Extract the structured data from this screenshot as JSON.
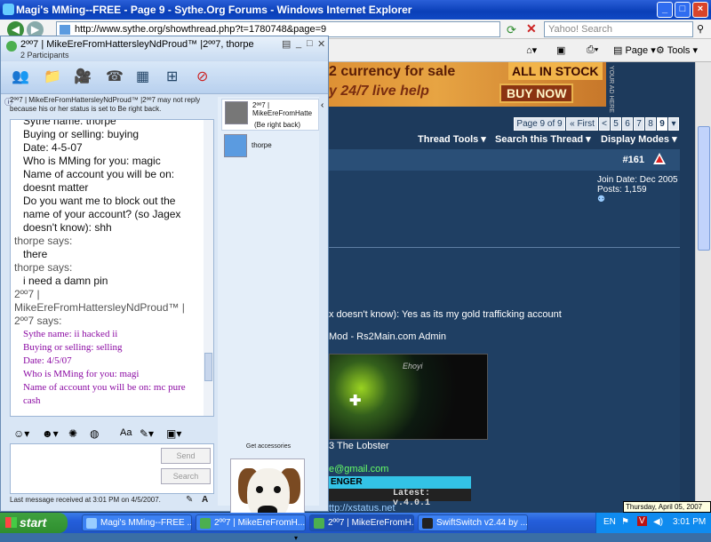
{
  "ie": {
    "title": "Magi's MMing--FREE - Page 9 - Sythe.Org Forums - Windows Internet Explorer",
    "url": "http://www.sythe.org/showthread.php?t=1780748&page=9",
    "search_placeholder": "Yahoo! Search",
    "cmd": {
      "page": "Page",
      "tools": "Tools"
    }
  },
  "banner": {
    "line1": "2 currency for sale",
    "line2": "y 24/7 live help",
    "stock": "ALL IN STOCK",
    "buy": "BUY NOW",
    "ad": "YOUR AD HERE"
  },
  "forum": {
    "pageof": "Page 9 of 9",
    "first": "« First",
    "prev": "<",
    "pages": [
      "5",
      "6",
      "7",
      "8",
      "9"
    ],
    "thread_tools": "Thread Tools",
    "search_thread": "Search this Thread",
    "display_modes": "Display Modes",
    "post_no": "#161",
    "join_date": "Join Date: Dec 2005",
    "posts": "Posts: 1,159",
    "text1": "x doesn't know): Yes as its my gold trafficking account",
    "text2": "Mod - Rs2Main.com Admin",
    "sig_name": "Ehoyi",
    "text3": "3 The Lobster",
    "email": "e@gmail.com",
    "status_label": "ENGER",
    "latest": "Latest: v.4.0.1",
    "status_url": "ttp://xstatus.net"
  },
  "msn": {
    "title": "2ºº7 | MikeEreFromHattersleyNdProud™ |2ºº7, thorpe",
    "participants": "2 Participants",
    "notice": "2ºº7 | MikeEreFromHattersleyNdProud™ |2ºº7 may not reply because his or her status is set to Be right back.",
    "chat": [
      {
        "k": "m",
        "t": "Sythe name: thorpe"
      },
      {
        "k": "m",
        "t": "Buying or selling: buying"
      },
      {
        "k": "m",
        "t": "Date: 4-5-07"
      },
      {
        "k": "m",
        "t": "Who is MMing for you: magic"
      },
      {
        "k": "m",
        "t": "Name of account you will be on:"
      },
      {
        "k": "m",
        "t": "doesnt matter"
      },
      {
        "k": "m",
        "t": "Do you want me to block out the"
      },
      {
        "k": "m",
        "t": "name of your account? (so Jagex"
      },
      {
        "k": "m",
        "t": "doesn't know): shh"
      },
      {
        "k": "u",
        "t": "thorpe says:"
      },
      {
        "k": "m",
        "t": "there"
      },
      {
        "k": "u",
        "t": "thorpe says:"
      },
      {
        "k": "m",
        "t": "i need a damn pin"
      },
      {
        "k": "u",
        "t": "2ºº7 |"
      },
      {
        "k": "u",
        "t": "MikeEreFromHattersleyNdProud™ |"
      },
      {
        "k": "u",
        "t": "2ºº7 says:"
      },
      {
        "k": "p",
        "t": "Sythe name: ii hacked ii"
      },
      {
        "k": "p",
        "t": "Buying or selling: selling"
      },
      {
        "k": "p",
        "t": "Date: 4/5/07"
      },
      {
        "k": "p",
        "t": "Who is MMing for you: magi"
      },
      {
        "k": "p",
        "t": "Name of account you will be on: mc pure"
      },
      {
        "k": "p",
        "t": "cash"
      }
    ],
    "send": "Send",
    "search": "Search",
    "last_msg": "Last message received at 3:01 PM on 4/5/2007.",
    "contacts": [
      {
        "name": "2ºº7 | MikeEreFromHatte",
        "status": "(Be right back)"
      },
      {
        "name": "thorpe",
        "status": ""
      }
    ],
    "accessories": "Get accessories"
  },
  "taskbar": {
    "start": "start",
    "tasks": [
      "Magi's MMing--FREE ...",
      "2ºº7 | MikeEreFromH...",
      "2ºº7 | MikeEreFromH...",
      "SwiftSwitch v2.44 by ..."
    ],
    "lang": "EN",
    "time": "3:01 PM",
    "date_tip": "Thursday, April 05, 2007"
  }
}
